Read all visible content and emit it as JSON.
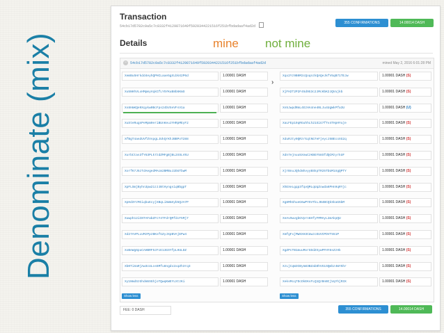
{
  "slide_title": "Denominate (mix)",
  "legend": {
    "mine": "mine",
    "not_mine": "not mine"
  },
  "header": {
    "title": "Transaction",
    "hash": "54cb17d5782c0a5c7c8332f4129871649f5920344221516f251bfbdadaaf4ad2d",
    "confirmations_label": "355 CONFIRMATIONS",
    "total_label": "14.00014 DASH"
  },
  "details": {
    "title": "Details"
  },
  "tx": {
    "hash": "54cb17d5782c0a5c7c8332f4129871649f5920344221516f251bfbdadaaf4ad2d",
    "mined": "mined May 2, 2016 6:01:28 PM"
  },
  "inputs": [
    {
      "address": "XemBu5Hrkdd4eyhQPHCLaae5gXLbkX2P6d",
      "amount": "1.00001 DASH"
    },
    {
      "address": "Xu5NHhVLxHMpmyVqkCfLY5YKuB8b6KmS",
      "amount": "1.00001 DASH"
    },
    {
      "address": "Xs8HmKQe9Xqykw0BcFps24bVXeVFsV1a",
      "amount": "1.00001 DASH"
    },
    {
      "address": "XuSteRugnPeMpm9eriBUnKeuJYHRpMEyF2",
      "amount": "1.00001 DASH"
    },
    {
      "address": "XfBgT4aeZUVfZVspgLJUkQrKhJBBPoT288",
      "amount": "1.00001 DASH"
    },
    {
      "address": "XurbCtas3fY63PLk7zdZMFgBjBL2XSLVkU",
      "amount": "1.00001 DASH"
    },
    {
      "address": "XorfK7J5zTdAegedMAcm2BMBuJ2DUTbwM",
      "amount": "1.00001 DASH"
    },
    {
      "address": "XpFLSmjByhn3pw21zJJBtHyngsiqBbgpT",
      "amount": "1.00001 DASH"
    },
    {
      "address": "XpHd3YzMCiqbuEcyjXBqLi5WmXyb5QJA7P",
      "amount": "1.00001 DASH"
    },
    {
      "address": "Xuwph12iCNTAFabZFcY4TFdrQMfdcF5Mj7",
      "amount": "1.00001 DASH"
    },
    {
      "address": "Xd27AVPLLUMzPpzBKsfGZyJXpBVAjEPw4",
      "amount": "1.00001 DASH"
    },
    {
      "address": "XoBeWg6puCAHBRF5zFcE13GSYfpLHULDZ",
      "amount": "1.00001 DASH"
    },
    {
      "address": "Xb0TiSaRjAw3cULos6Mfu8ngdx2xqZh3rq3",
      "amount": "1.00001 DASH"
    },
    {
      "address": "Xy1NmdSzGhdm5SGhjoTQwqKWEYLXtzKi",
      "amount": "1.00001 DASH"
    }
  ],
  "outputs": [
    {
      "address": "Xqx2Yz9B0M2cQoqnzkQAQeJkfV5qB71TEJw",
      "amount": "1.00001 DASH",
      "tag": "(S)",
      "tag_color": "#d23b3b"
    },
    {
      "address": "XjFH2T2P2F45d9G3c2JMcKbK2JQVujkb",
      "amount": "1.00001 DASH",
      "tag": "(S)",
      "tag_color": "#d23b3b"
    },
    {
      "address": "Xn5JwpdRmL4EzHA4ne4NLJu4UgWkPfa3U",
      "amount": "1.00001 DASH",
      "tag": "(U)",
      "tag_color": "#2d7fc0"
    },
    {
      "address": "XaLFEp19qRGuhhLh21SiG7fTv4THpHYuje",
      "amount": "1.00001 DASH",
      "tag": "(S)",
      "tag_color": "#d23b3b"
    },
    {
      "address": "XduRJty9QRzrkqtNG7eFjeycJ5BEcoXG2q",
      "amount": "1.00001 DASH",
      "tag": "(S)",
      "tag_color": "#d23b3b"
    },
    {
      "address": "Xdn7ejnuu5XnwCzKBGY58SfdQCMzyrkUF",
      "amount": "1.00001 DASH",
      "tag": "(S)",
      "tag_color": "#d23b3b"
    },
    {
      "address": "XjrBnuJQhdmhvyyBSkpTR25TbUM1XgQPTY",
      "amount": "1.00001 DASH",
      "tag": "(S)",
      "tag_color": "#d23b3b"
    },
    {
      "address": "XhEXeLgqp3fqvQMLqUqZowda6PHn9qRYjc",
      "amount": "1.00001 DASH",
      "tag": "(S)",
      "tag_color": "#d23b3b"
    },
    {
      "address": "Xg8MhGhueG6wPY5VTkLJB4BCQkSkaG5bM",
      "amount": "1.00001 DASH",
      "tag": "(S)",
      "tag_color": "#d23b3b"
    },
    {
      "address": "XeAvSwvgbGVprn6HfyFMMAyL2mAkpQU",
      "amount": "1.00001 DASH",
      "tag": "(S)",
      "tag_color": "#d23b3b"
    },
    {
      "address": "XmfgFxjMWSXH3CUwzcEUVCPDVT551P",
      "amount": "1.00001 DASH",
      "tag": "(S)",
      "tag_color": "#d23b3b"
    },
    {
      "address": "XgZPcTB1muuMorGDdZXywPFHY8sZzHk",
      "amount": "1.00001 DASH",
      "tag": "(S)",
      "tag_color": "#d23b3b"
    },
    {
      "address": "XzLjCqW3CBym83BZabDhVG1SQmbz4WY5hr",
      "amount": "1.00001 DASH",
      "tag": "(S)",
      "tag_color": "#d23b3b"
    },
    {
      "address": "XeksMcq7DcDkEKsFLQ1QzBnBCjVqYhjR3X",
      "amount": "1.00001 DASH",
      "tag": "(S)",
      "tag_color": "#d23b3b"
    }
  ],
  "show_less_label": "Show less",
  "footer": {
    "fee_label": "FEE: 0 DASH",
    "confirmations_label": "355 CONFIRMATIONS",
    "total_label": "14.00014 DASH"
  },
  "colors": {
    "title_blue": "#1a7fa6",
    "mine": "#e8822c",
    "not_mine": "#6fae3c",
    "confirm_blue": "#2d8fd2",
    "dash_green": "#4fb957"
  }
}
